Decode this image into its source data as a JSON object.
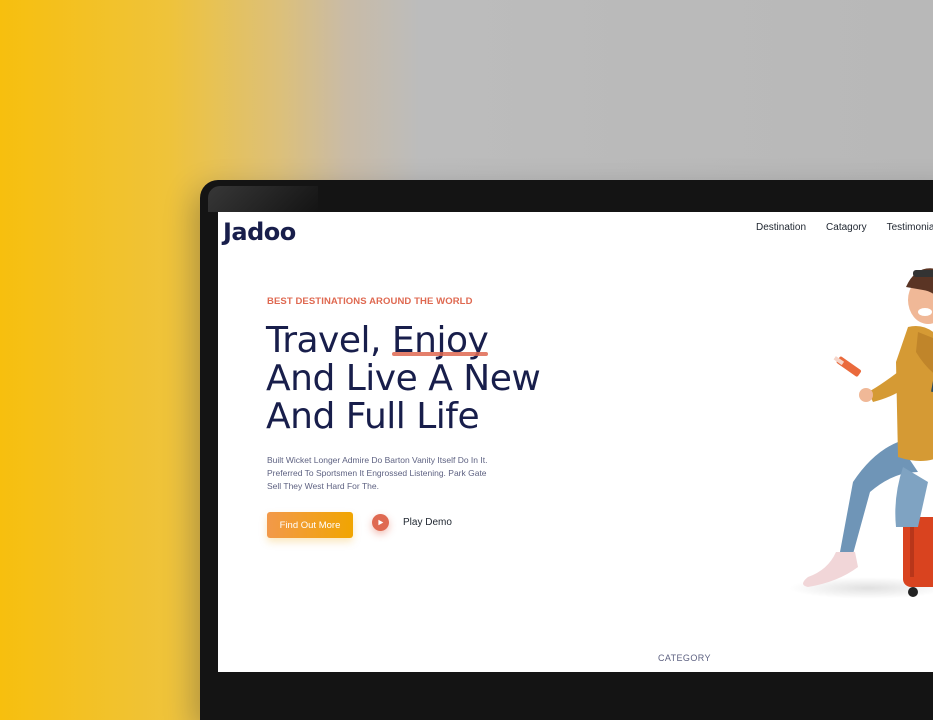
{
  "site": {
    "logo": "Jadoo"
  },
  "nav": {
    "items": [
      "Destination",
      "Catagory",
      "Testimonia"
    ]
  },
  "hero": {
    "eyebrow": "BEST DESTINATIONS AROUND THE WORLD",
    "headline": {
      "line1_prefix": "Travel, ",
      "line1_emphasis": "Enjoy",
      "line2": "And Live A New",
      "line3": "And Full Life"
    },
    "description": [
      "Built Wicket Longer Admire Do Barton Vanity Itself Do In It.",
      "Preferred To Sportsmen It Engrossed Listening. Park Gate",
      "Sell They West Hard For The."
    ],
    "cta_label": "Find Out More",
    "play_label": "Play Demo"
  },
  "section": {
    "category_label": "CATEGORY"
  },
  "colors": {
    "accent": "#df6951",
    "cta": "#f1a501",
    "text_dark": "#181e4b",
    "text_muted": "#5e6282"
  },
  "icons": {
    "play": "play-icon"
  }
}
